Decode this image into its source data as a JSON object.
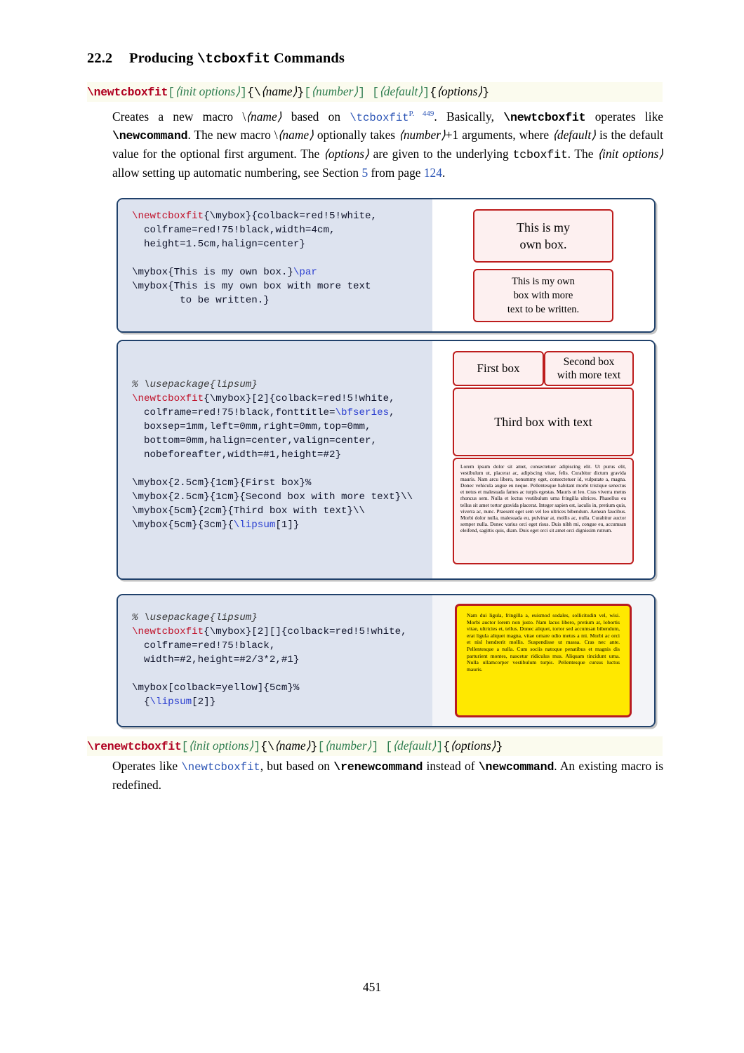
{
  "page": {
    "number": "451",
    "section": {
      "number": "22.2",
      "title_pre": "Producing ",
      "title_mono": "\\tcboxfit",
      "title_post": " Commands"
    }
  },
  "commands": [
    {
      "name": "\\newtcboxfit",
      "signature_parts": [
        "[",
        "init options",
        "]",
        "{\\",
        "name",
        "}",
        "[",
        "number",
        "]",
        "[",
        "default",
        "]",
        "{",
        "options",
        "}"
      ],
      "description_lines": [
        "Creates a new macro \\⟨name⟩ based on \\tcboxfit ↗P. 449. Basically, \\newtcboxfit oper-",
        "ates like \\newcommand. The new macro \\⟨name⟩ optionally takes ⟨number⟩+1 arguments,",
        "where ⟨default⟩ is the default value for the optional first argument. The ⟨options⟩ are given",
        "to the underlying tcboxfit. The ⟨init options⟩ allow setting up automatic numbering, see",
        "Section 5 from page 124."
      ],
      "xref_page": "P. 449",
      "xref_target": "\\tcboxfit",
      "see_section": "5",
      "see_page": "124"
    },
    {
      "name": "\\renewtcboxfit",
      "description_lines": [
        "Operates like \\newtcboxfit, but based on \\renewcommand instead of \\newcommand. An",
        "existing macro is redefined."
      ]
    }
  ],
  "examples": [
    {
      "id": "example-1",
      "code": [
        {
          "segments": [
            {
              "t": "\\newtcboxfit",
              "c": "red"
            },
            {
              "t": "{\\mybox}{colback=red!5!white,",
              "c": "n"
            }
          ]
        },
        {
          "segments": [
            {
              "t": "  colframe=red!75!black,width=4cm,",
              "c": "n"
            }
          ]
        },
        {
          "segments": [
            {
              "t": "  height=1.5cm,halign=center}",
              "c": "n"
            }
          ]
        },
        {
          "segments": [
            {
              "t": "",
              "c": "n"
            }
          ]
        },
        {
          "segments": [
            {
              "t": "\\mybox{This is my own box.}",
              "c": "n"
            },
            {
              "t": "\\par",
              "c": "blue"
            }
          ]
        },
        {
          "segments": [
            {
              "t": "\\mybox{This is my own box with more text",
              "c": "n"
            }
          ]
        },
        {
          "segments": [
            {
              "t": "        to be written.}",
              "c": "n"
            }
          ]
        }
      ],
      "output_boxes": [
        {
          "name": "result-box-1",
          "lines": [
            "This is my",
            "own box."
          ]
        },
        {
          "name": "result-box-2",
          "lines": [
            "This is my own",
            "box with more",
            "text to be written."
          ]
        }
      ]
    },
    {
      "id": "example-2",
      "code": [
        {
          "segments": [
            {
              "t": "% \\usepackage{lipsum}",
              "c": "com"
            }
          ]
        },
        {
          "segments": [
            {
              "t": "\\newtcboxfit",
              "c": "red"
            },
            {
              "t": "{\\mybox}[2]{colback=red!5!white,",
              "c": "n"
            }
          ]
        },
        {
          "segments": [
            {
              "t": "  colframe=red!75!black,fonttitle=",
              "c": "n"
            },
            {
              "t": "\\bfseries",
              "c": "blue"
            },
            {
              "t": ",",
              "c": "n"
            }
          ]
        },
        {
          "segments": [
            {
              "t": "  boxsep=1mm,left=0mm,right=0mm,top=0mm,",
              "c": "n"
            }
          ]
        },
        {
          "segments": [
            {
              "t": "  bottom=0mm,halign=center,valign=center,",
              "c": "n"
            }
          ]
        },
        {
          "segments": [
            {
              "t": "  nobeforeafter,width=#1,height=#2}",
              "c": "n"
            }
          ]
        },
        {
          "segments": [
            {
              "t": "",
              "c": "n"
            }
          ]
        },
        {
          "segments": [
            {
              "t": "\\mybox{2.5cm}{1cm}{First box}%",
              "c": "n"
            }
          ]
        },
        {
          "segments": [
            {
              "t": "\\mybox{2.5cm}{1cm}{Second box with more text}\\\\",
              "c": "n"
            }
          ]
        },
        {
          "segments": [
            {
              "t": "\\mybox{5cm}{2cm}{Third box with text}\\\\",
              "c": "n"
            }
          ]
        },
        {
          "segments": [
            {
              "t": "\\mybox{5cm}{3cm}{",
              "c": "n"
            },
            {
              "t": "\\lipsum",
              "c": "blue"
            },
            {
              "t": "[1]}",
              "c": "n"
            }
          ]
        }
      ],
      "output_boxes": [
        {
          "name": "result-box-first",
          "text": "First box"
        },
        {
          "name": "result-box-second",
          "lines": [
            "Second box",
            "with more text"
          ]
        },
        {
          "name": "result-box-third",
          "text": "Third box with text"
        },
        {
          "name": "result-box-lipsum1",
          "text": "Lorem ipsum dolor sit amet, consectetuer adipiscing elit. Ut purus elit, vestibulum ut, placerat ac, adipiscing vitae, felis. Curabitur dictum gravida mauris. Nam arcu libero, nonummy eget, consectetuer id, vulputate a, magna. Donec vehicula augue eu neque. Pellentesque habitant morbi tristique senectus et netus et malesuada fames ac turpis egestas. Mauris ut leo. Cras viverra metus rhoncus sem. Nulla et lectus vestibulum urna fringilla ultrices. Phasellus eu tellus sit amet tortor gravida placerat. Integer sapien est, iaculis in, pretium quis, viverra ac, nunc. Praesent eget sem vel leo ultrices bibendum. Aenean faucibus. Morbi dolor nulla, malesuada eu, pulvinar at, mollis ac, nulla. Curabitur auctor semper nulla. Donec varius orci eget risus. Duis nibh mi, congue eu, accumsan eleifend, sagittis quis, diam. Duis eget orci sit amet orci dignissim rutrum."
        }
      ]
    },
    {
      "id": "example-3",
      "code": [
        {
          "segments": [
            {
              "t": "% \\usepackage{lipsum}",
              "c": "com"
            }
          ]
        },
        {
          "segments": [
            {
              "t": "\\newtcboxfit",
              "c": "red"
            },
            {
              "t": "{\\mybox}[2][]{colback=red!5!white,",
              "c": "n"
            }
          ]
        },
        {
          "segments": [
            {
              "t": "  colframe=red!75!black,",
              "c": "n"
            }
          ]
        },
        {
          "segments": [
            {
              "t": "  width=#2,height=#2/3*2,#1}",
              "c": "n"
            }
          ]
        },
        {
          "segments": [
            {
              "t": "",
              "c": "n"
            }
          ]
        },
        {
          "segments": [
            {
              "t": "\\mybox[colback=yellow]{5cm}%",
              "c": "n"
            }
          ]
        },
        {
          "segments": [
            {
              "t": "  {",
              "c": "n"
            },
            {
              "t": "\\lipsum",
              "c": "blue"
            },
            {
              "t": "[2]}",
              "c": "n"
            }
          ]
        }
      ],
      "output_boxes": [
        {
          "name": "result-box-yellow",
          "text": "Nam dui ligula, fringilla a, euismod sodales, sollicitudin vel, wisi. Morbi auctor lorem non justo. Nam lacus libero, pretium at, lobortis vitae, ultricies et, tellus. Donec aliquet, tortor sed accumsan bibendum, erat ligula aliquet magna, vitae ornare odio metus a mi. Morbi ac orci et nisl hendrerit mollis. Suspendisse ut massa. Cras nec ante. Pellentesque a nulla. Cum sociis natoque penatibus et magnis dis parturient montes, nascetur ridiculus mus. Aliquam tincidunt urna. Nulla ullamcorper vestibulum turpis. Pellentesque cursus luctus mauris."
        }
      ]
    }
  ],
  "colors": {
    "command_name": "#b00020",
    "optional_arg": "#2e7d4f",
    "link": "#2b54b5",
    "example_border": "#20416b",
    "code_background": "#dde3ef",
    "result_frame": "#bd1d1d",
    "result_background": "#fdf0f0",
    "yellow_background": "#ffe800",
    "band_background": "#fbfbee"
  }
}
